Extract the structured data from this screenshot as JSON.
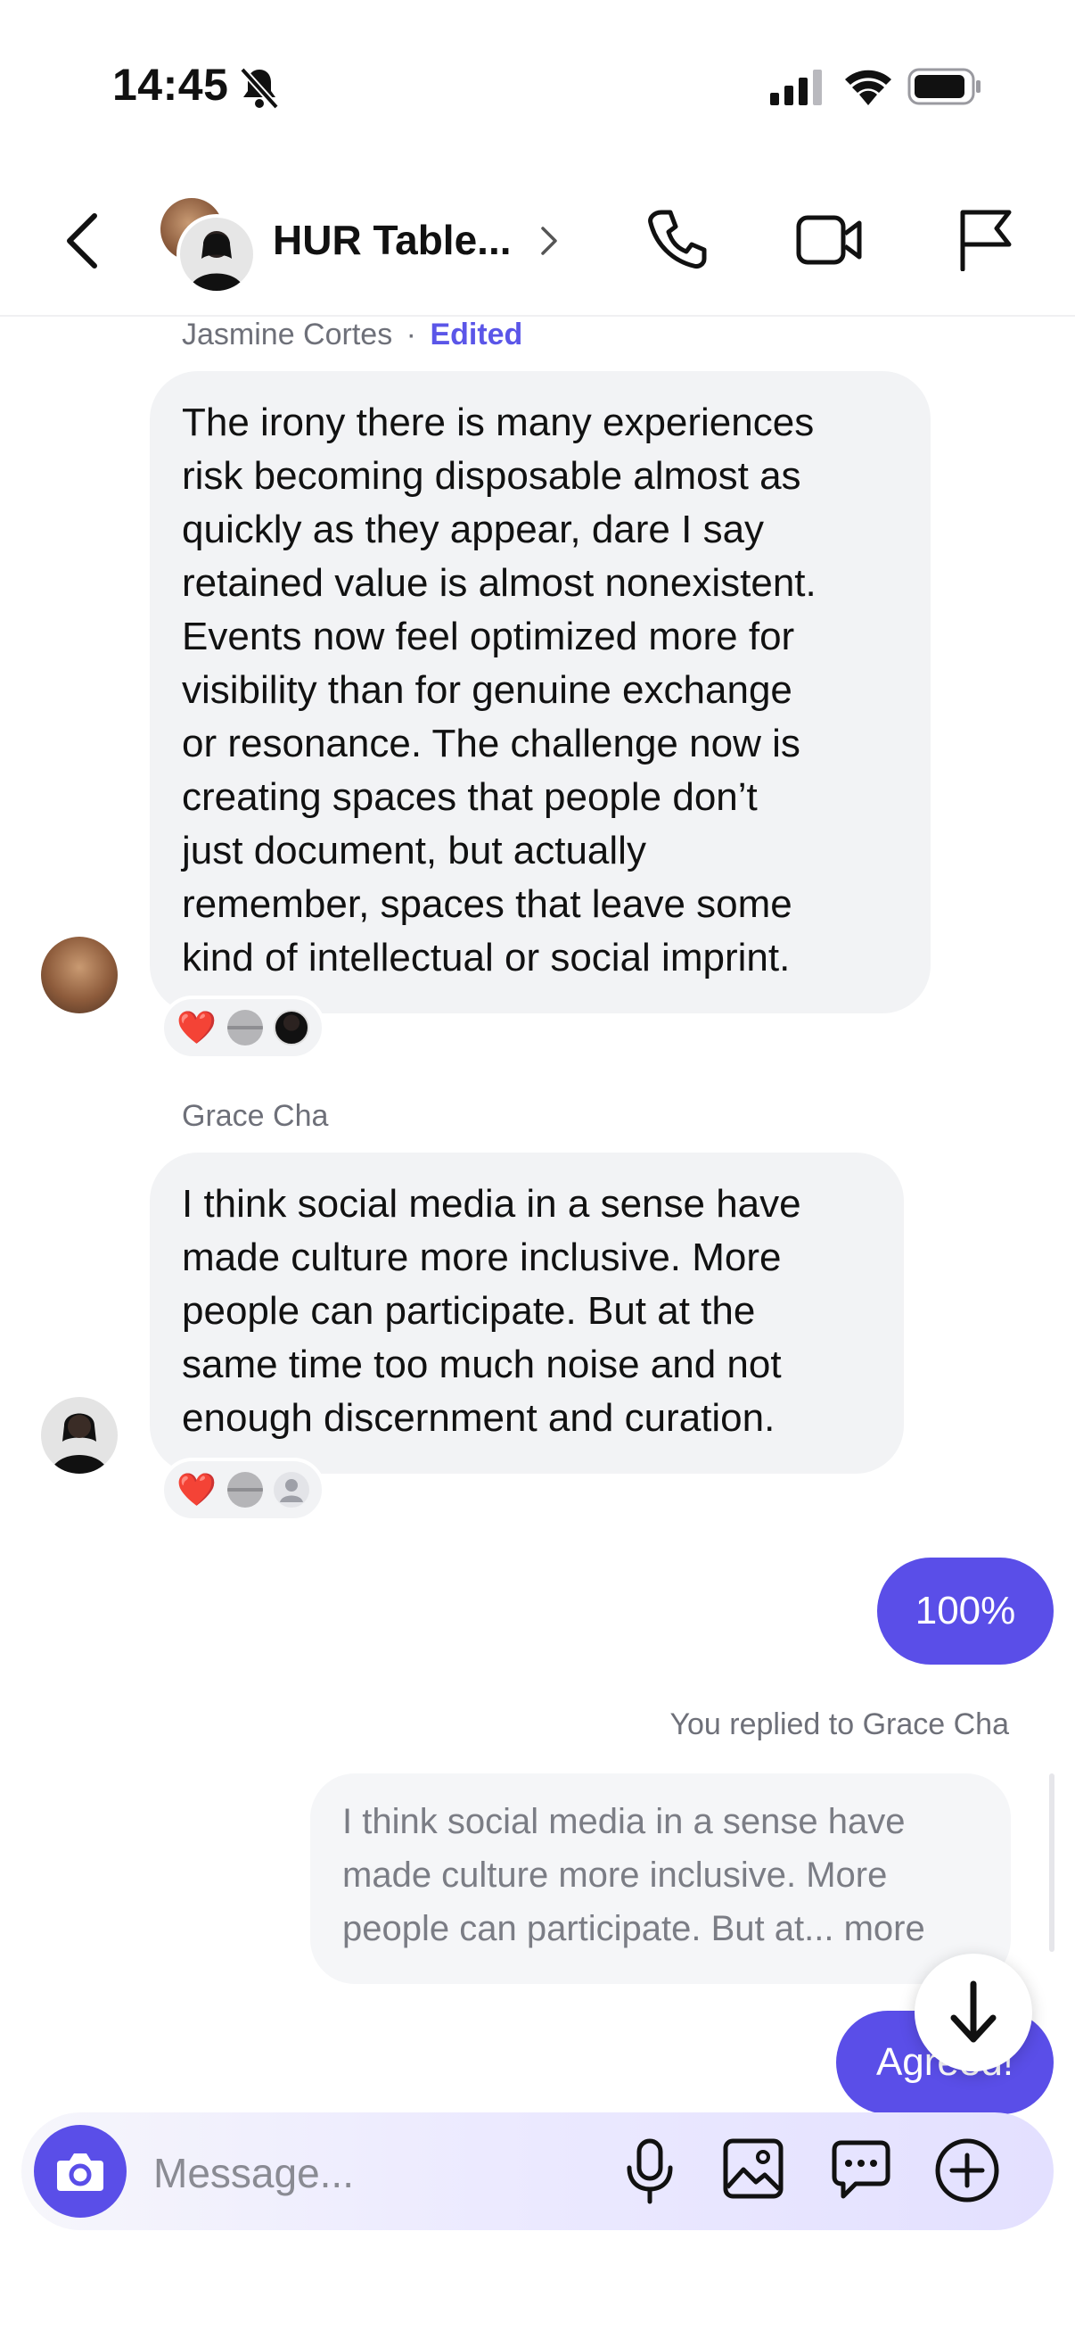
{
  "status_bar": {
    "time": "14:45",
    "icons": [
      "bell-slash-icon",
      "signal-icon",
      "wifi-icon",
      "battery-icon"
    ]
  },
  "header": {
    "title": "HUR Table...",
    "icons": [
      "back-chevron-icon",
      "phone-icon",
      "video-icon",
      "flag-icon"
    ]
  },
  "messages": [
    {
      "sender": "Jasmine Cortes",
      "separator": "·",
      "edited_label": "Edited",
      "lines": [
        "The irony there is many experiences",
        "risk becoming disposable almost as",
        "quickly as they appear, dare I say",
        "retained value is almost nonexistent.",
        "Events now feel optimized more for",
        "visibility than for genuine exchange",
        "or resonance. The challenge now is",
        "creating spaces that people don’t",
        "just document, but actually",
        "remember, spaces that leave some",
        "kind of intellectual or social imprint."
      ],
      "reaction_emoji": "❤️"
    },
    {
      "sender": "Grace Cha",
      "lines": [
        "I think social media in a sense have",
        "made culture more inclusive. More",
        "people can participate. But at the",
        "same time too much noise and not",
        "enough discernment and curation."
      ],
      "reaction_emoji": "❤️"
    }
  ],
  "outgoing": {
    "first": "100%",
    "reply_note": "You replied to Grace Cha",
    "quoted_lines": [
      "I think social media in a sense have",
      "made culture more inclusive. More",
      "people can participate. But at... more"
    ],
    "second": "Agreed!"
  },
  "composer": {
    "placeholder": "Message...",
    "icons": [
      "camera-icon",
      "microphone-icon",
      "image-icon",
      "chat-bubble-icon",
      "plus-circle-icon"
    ]
  },
  "colors": {
    "accent": "#5a4ee8",
    "bubble_in": "#f2f3f5",
    "edited": "#5b56e8"
  }
}
